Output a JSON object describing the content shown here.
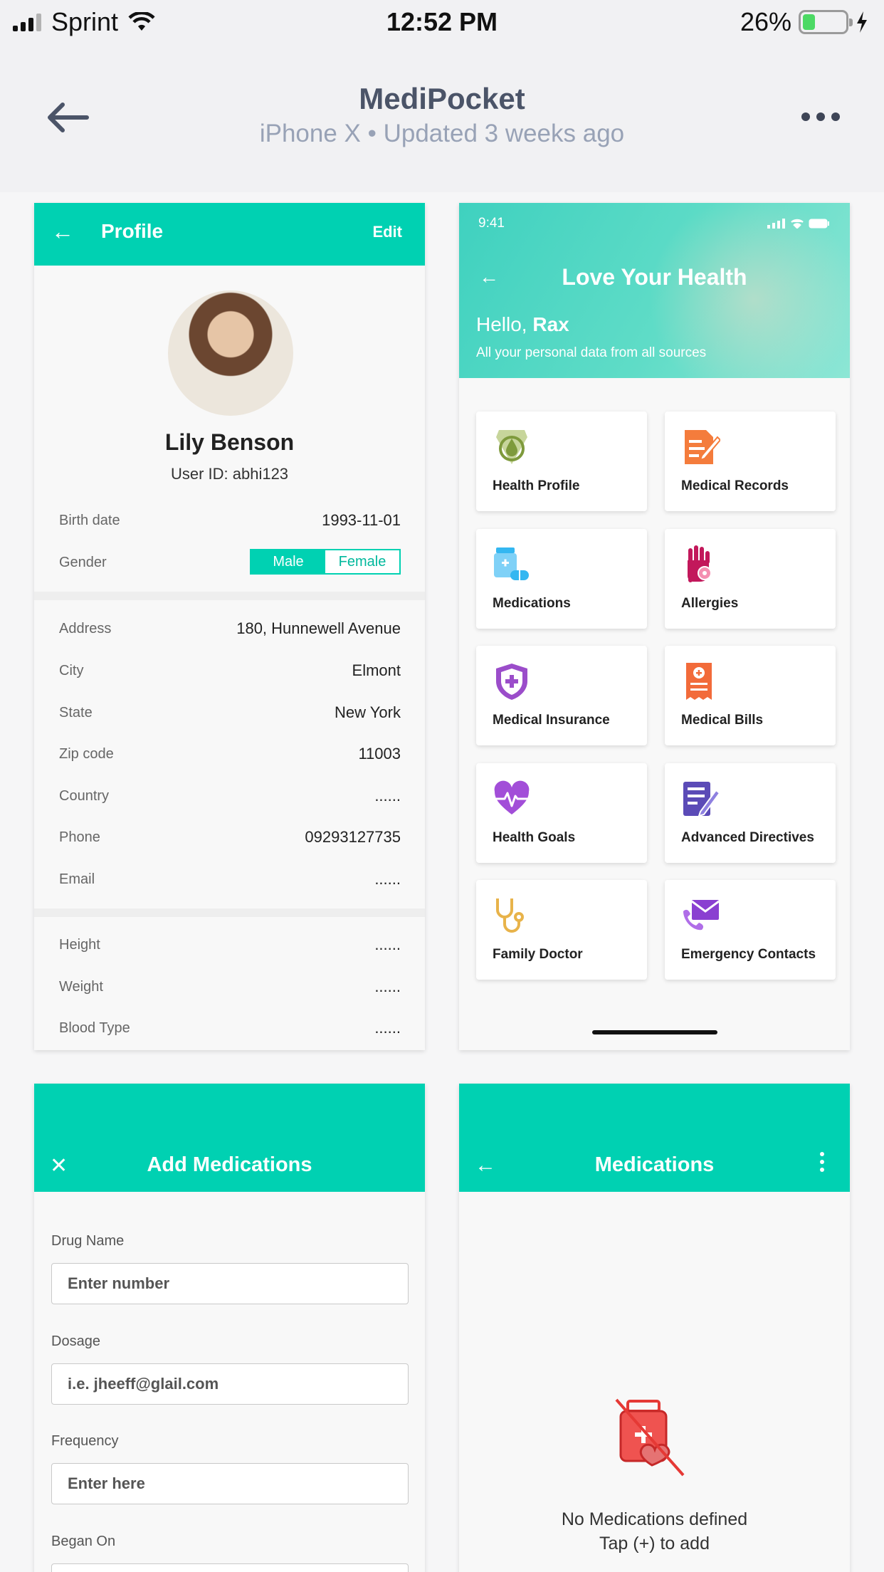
{
  "status_bar": {
    "carrier": "Sprint",
    "time": "12:52 PM",
    "battery": "26%",
    "battery_level": 0.26
  },
  "app_header": {
    "title": "MediPocket",
    "subtitle": "iPhone X • Updated 3 weeks ago"
  },
  "profile": {
    "header": {
      "title": "Profile",
      "edit": "Edit"
    },
    "name": "Lily Benson",
    "user_id": "User ID: abhi123",
    "birth_date": {
      "label": "Birth date",
      "value": "1993-11-01"
    },
    "gender": {
      "label": "Gender",
      "options": [
        "Male",
        "Female"
      ],
      "selected": "Male"
    },
    "address_fields": [
      {
        "label": "Address",
        "value": "180, Hunnewell Avenue"
      },
      {
        "label": "City",
        "value": "Elmont"
      },
      {
        "label": "State",
        "value": "New York"
      },
      {
        "label": "Zip code",
        "value": "11003"
      },
      {
        "label": "Country",
        "value": "......"
      },
      {
        "label": "Phone",
        "value": "09293127735"
      },
      {
        "label": "Email",
        "value": "......"
      }
    ],
    "body_fields": [
      {
        "label": "Height",
        "value": "......"
      },
      {
        "label": "Weight",
        "value": "......"
      },
      {
        "label": "Blood Type",
        "value": "......"
      }
    ]
  },
  "dashboard": {
    "time": "9:41",
    "title": "Love Your Health",
    "greeting": "Hello, ",
    "user": "Rax",
    "subtitle": "All your personal data from all sources",
    "tiles": [
      {
        "label": "Health Profile",
        "icon": "drop-badge-icon",
        "color": "#7e9a3c"
      },
      {
        "label": "Medical Records",
        "icon": "document-pen-icon",
        "color": "#f47c3c"
      },
      {
        "label": "Medications",
        "icon": "pill-bottle-icon",
        "color": "#34b7f1"
      },
      {
        "label": "Allergies",
        "icon": "hand-virus-icon",
        "color": "#c2185b"
      },
      {
        "label": "Medical Insurance",
        "icon": "shield-plus-icon",
        "color": "#9b4dca"
      },
      {
        "label": "Medical Bills",
        "icon": "bill-icon",
        "color": "#f26b3a"
      },
      {
        "label": "Health Goals",
        "icon": "heartbeat-icon",
        "color": "#a24ed8"
      },
      {
        "label": "Advanced Directives",
        "icon": "checklist-pen-icon",
        "color": "#5b4bb7"
      },
      {
        "label": "Family Doctor",
        "icon": "stethoscope-icon",
        "color": "#e8b34a"
      },
      {
        "label": "Emergency Contacts",
        "icon": "phone-mail-icon",
        "color": "#8a3fd1"
      }
    ]
  },
  "add_medications": {
    "title": "Add Medications",
    "fields": [
      {
        "label": "Drug Name",
        "placeholder": "Enter number"
      },
      {
        "label": "Dosage",
        "placeholder": "i.e. jheeff@glail.com"
      },
      {
        "label": "Frequency",
        "placeholder": "Enter here"
      },
      {
        "label": "Began On",
        "placeholder": ""
      }
    ]
  },
  "medications": {
    "title": "Medications",
    "empty_line1": "No Medications defined",
    "empty_line2": "Tap (+) to add"
  },
  "colors": {
    "accent": "#00d1b2",
    "empty_icon": "#e53935"
  }
}
